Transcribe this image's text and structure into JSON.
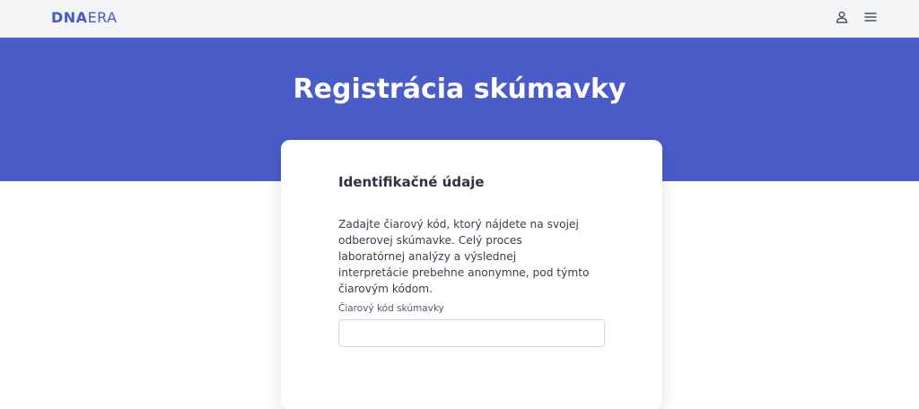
{
  "header": {
    "logo_bold": "DNA",
    "logo_light": "ERA",
    "icons": [
      "user-icon",
      "menu-icon"
    ]
  },
  "hero": {
    "title": "Registrácia skúmavky"
  },
  "card": {
    "heading": "Identifikačné údaje",
    "description": "Zadajte čiarový kód, ktorý nájdete na svojej odberovej skúmavke. Celý proces laboratórnej analýzy a výslednej interpretácie prebehne anonymne, pod týmto čiarovým kódom.",
    "field_label": "Čiarový kód skúmavky",
    "field_value": "",
    "field_placeholder": ""
  },
  "colors": {
    "brand": "#4a5cc8",
    "topbar": "#f3f4f6"
  }
}
